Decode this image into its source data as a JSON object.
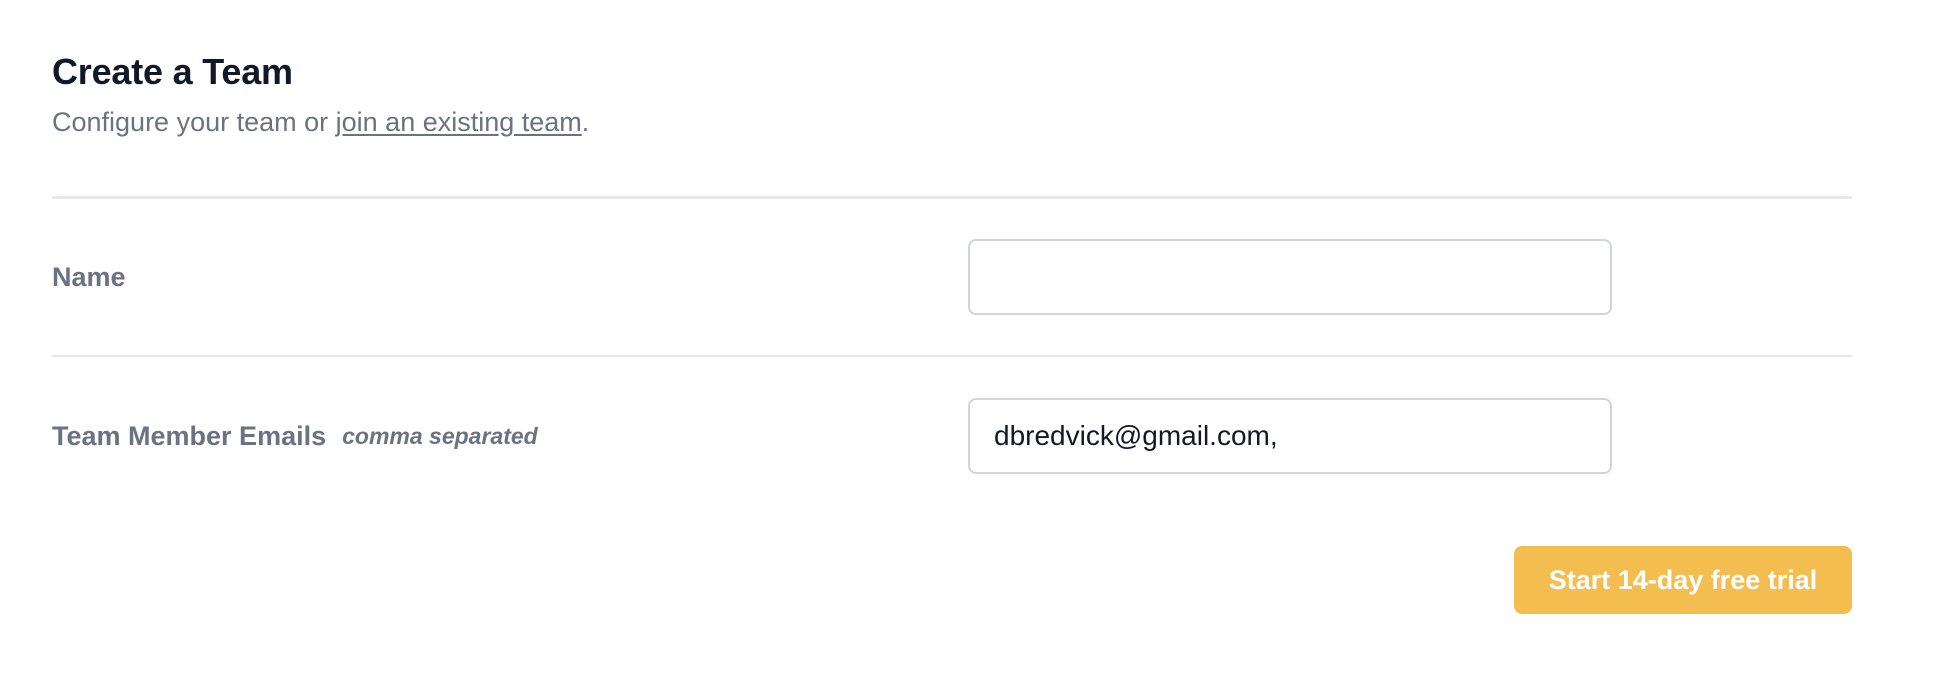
{
  "header": {
    "title": "Create a Team",
    "subtitle_prefix": "Configure your team or ",
    "subtitle_link": "join an existing team",
    "subtitle_suffix": "."
  },
  "form": {
    "name": {
      "label": "Name",
      "value": ""
    },
    "emails": {
      "label": "Team Member Emails",
      "hint": "comma separated",
      "value": "dbredvick@gmail.com,"
    }
  },
  "actions": {
    "submit_label": "Start 14-day free trial"
  },
  "colors": {
    "accent": "#f3bd4f",
    "title": "#111827",
    "muted": "#6b7280",
    "divider": "#e5e7eb"
  }
}
